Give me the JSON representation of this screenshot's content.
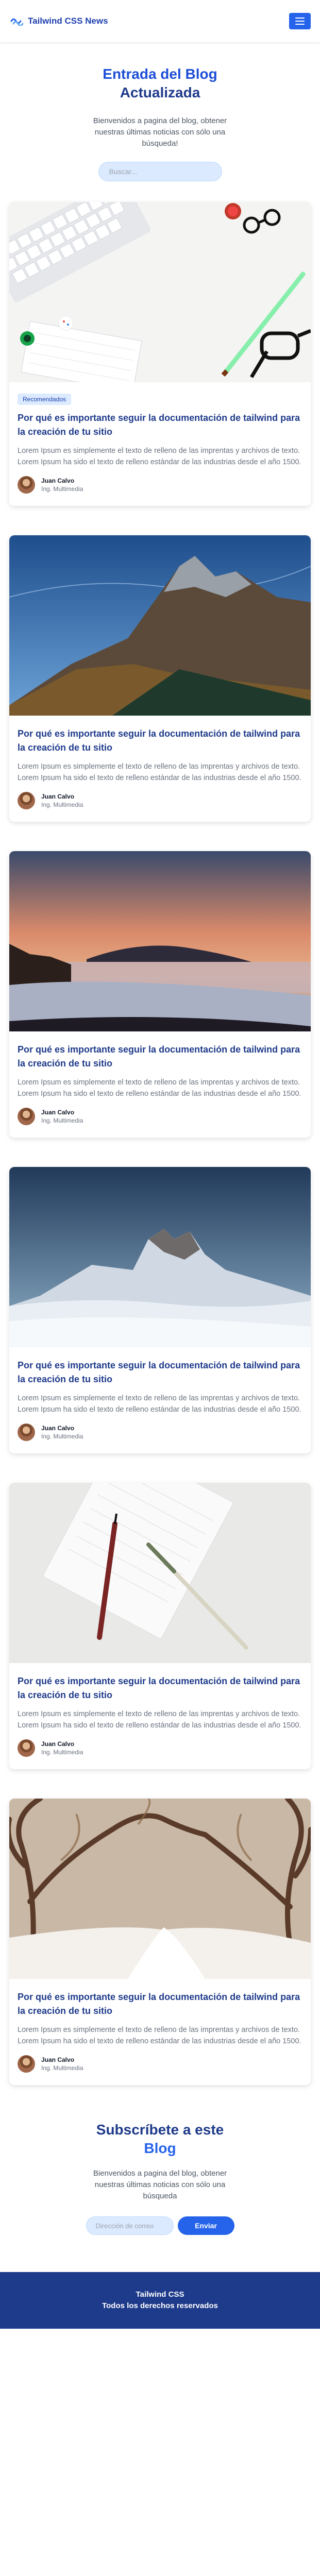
{
  "nav": {
    "brand": "Tailwind CSS News",
    "logo_icon": "wave-logo-icon",
    "menu_icon": "hamburger-icon"
  },
  "hero": {
    "title_line1": "Entrada del Blog",
    "title_line2": "Actualizada",
    "description": "Bienvenidos a pagina del blog, obtener nuestras últimas noticias con sólo una búsqueda!",
    "search_placeholder": "Buscar..."
  },
  "posts": [
    {
      "badge": "Recomendados",
      "title": "Por qué es importante seguir la documentación de tailwind para la creación de tu sitio",
      "excerpt": "Lorem Ipsum es simplemente el texto de relleno de las imprentas y archivos de texto. Lorem Ipsum ha sido el texto de relleno estándar de las industrias desde el año 1500.",
      "author": "Juan Calvo",
      "role": "Ing. Multimedia",
      "image": "desk-keyboard-glasses"
    },
    {
      "badge": "",
      "title": "Por qué es importante seguir la documentación de tailwind para la creación de tu sitio",
      "excerpt": "Lorem Ipsum es simplemente el texto de relleno de las imprentas y archivos de texto. Lorem Ipsum ha sido el texto de relleno estándar de las industrias desde el año 1500.",
      "author": "Juan Calvo",
      "role": "Ing. Multimedia",
      "image": "mountain-blue-sky"
    },
    {
      "badge": "",
      "title": "Por qué es importante seguir la documentación de tailwind para la creación de tu sitio",
      "excerpt": "Lorem Ipsum es simplemente el texto de relleno de las imprentas y archivos de texto. Lorem Ipsum ha sido el texto de relleno estándar de las industrias desde el año 1500.",
      "author": "Juan Calvo",
      "role": "Ing. Multimedia",
      "image": "sunset-fog-island"
    },
    {
      "badge": "",
      "title": "Por qué es importante seguir la documentación de tailwind para la creación de tu sitio",
      "excerpt": "Lorem Ipsum es simplemente el texto de relleno de las imprentas y archivos de texto. Lorem Ipsum ha sido el texto de relleno estándar de las industrias desde el año 1500.",
      "author": "Juan Calvo",
      "role": "Ing. Multimedia",
      "image": "snowy-mountain"
    },
    {
      "badge": "",
      "title": "Por qué es importante seguir la documentación de tailwind para la creación de tu sitio",
      "excerpt": "Lorem Ipsum es simplemente el texto de relleno de las imprentas y archivos de texto. Lorem Ipsum ha sido el texto de relleno estándar de las industrias desde el año 1500.",
      "author": "Juan Calvo",
      "role": "Ing. Multimedia",
      "image": "notebook-pens"
    },
    {
      "badge": "",
      "title": "Por qué es importante seguir la documentación de tailwind para la creación de tu sitio",
      "excerpt": "Lorem Ipsum es simplemente el texto de relleno de las imprentas y archivos de texto. Lorem Ipsum ha sido el texto de relleno estándar de las industrias desde el año 1500.",
      "author": "Juan Calvo",
      "role": "Ing. Multimedia",
      "image": "winter-tree-path"
    }
  ],
  "subscribe": {
    "title_line1": "Subscríbete a este",
    "title_line2": "Blog",
    "description": "Bienvenidos a pagina del blog, obtener nuestras últimas noticias con sólo una búsqueda",
    "email_placeholder": "Dirección de correo",
    "button": "Enviar"
  },
  "footer": {
    "line1": "Tailwind CSS",
    "line2": "Todos los derechos reservados"
  },
  "colors": {
    "primary": "#2563eb",
    "heading": "#1e3a8a",
    "footer": "#1e3a8a"
  }
}
